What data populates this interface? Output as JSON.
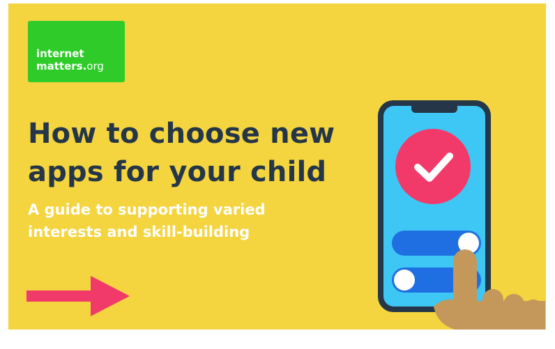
{
  "logo": {
    "line1": "internet",
    "line2": "matters",
    "dot": ".",
    "domain": "org"
  },
  "title": "How to choose new apps for your child",
  "subtitle": "A guide to supporting varied interests and skill-building",
  "colors": {
    "background": "#f4d43f",
    "logo_green": "#2ecb29",
    "title_navy": "#243648",
    "arrow_pink": "#f23a6a",
    "phone_screen": "#3ec7f4",
    "check_circle": "#f23a6a",
    "toggle_blue": "#1f6fe2",
    "hand": "#c4975a"
  },
  "icons": [
    "right-arrow-icon",
    "smartphone-icon",
    "checkmark-icon",
    "toggle-switch-icon",
    "pointing-hand-icon"
  ]
}
